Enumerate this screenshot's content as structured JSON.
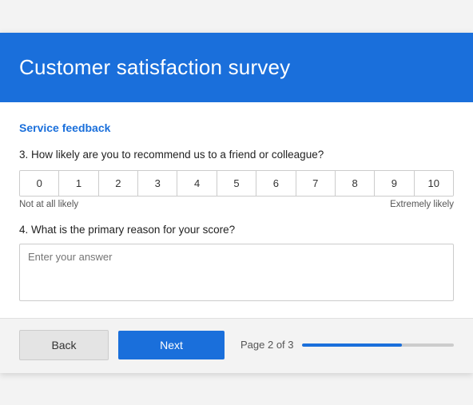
{
  "header": {
    "title": "Customer satisfaction survey"
  },
  "section": {
    "label": "Service feedback"
  },
  "question3": {
    "number": "3.",
    "text": "How likely are you to recommend us to a friend or colleague?",
    "scale": [
      "0",
      "1",
      "2",
      "3",
      "4",
      "5",
      "6",
      "7",
      "8",
      "9",
      "10"
    ],
    "label_left": "Not at all likely",
    "label_right": "Extremely likely"
  },
  "question4": {
    "number": "4.",
    "text": "What is the primary reason for your score?",
    "placeholder": "Enter your answer"
  },
  "footer": {
    "back_label": "Back",
    "next_label": "Next",
    "page_text": "Page 2 of 3",
    "progress_percent": 66
  }
}
